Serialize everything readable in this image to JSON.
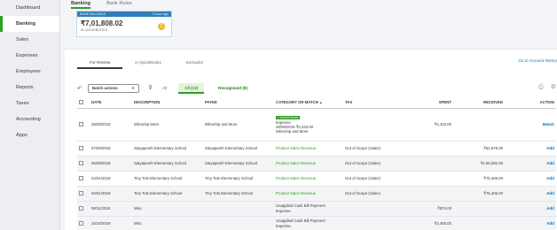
{
  "sidebar": {
    "items": [
      {
        "label": "Dashboard"
      },
      {
        "label": "Banking"
      },
      {
        "label": "Sales"
      },
      {
        "label": "Expenses"
      },
      {
        "label": "Employees"
      },
      {
        "label": "Reports"
      },
      {
        "label": "Taxes"
      },
      {
        "label": "Accounting"
      },
      {
        "label": "Apps"
      }
    ],
    "active_index": 1
  },
  "top_tabs": [
    {
      "label": "Banking"
    },
    {
      "label": "Bank Rules"
    }
  ],
  "bank_card": {
    "header_left": "BANK BALANCE",
    "header_right": "1 hour ago",
    "amount": "₹7,01,808.02",
    "sublabel": "IN QUICKBOOKS",
    "warn_glyph": "!"
  },
  "review_tabs": [
    {
      "label": "For Review"
    },
    {
      "label": "In QuickBooks"
    },
    {
      "label": "Excluded"
    }
  ],
  "go_register": "Go to Account history",
  "toolbar": {
    "batch_actions": "Batch actions",
    "filter_all": "All",
    "pill_all": "All (12)",
    "pill_recognised": "Recognised (8)"
  },
  "table": {
    "headers": [
      "DATE",
      "DESCRIPTION",
      "PAYEE",
      "CATEGORY OR MATCH",
      "TAX",
      "SPENT",
      "RECEIVED",
      "ACTION"
    ],
    "rows": [
      {
        "date": "28/08/2018",
        "description": "Milroship More",
        "payee": "Milroship and More",
        "badge": "1 record found",
        "cat1": "Expense",
        "cat2": "28/08/2018 ₹2,423.00",
        "cat3": "Milroship and More",
        "tax": "",
        "spent": "₹2,423.00",
        "received": "",
        "action": "Match"
      },
      {
        "date": "07/09/2018",
        "description": "Satyapeeth Elementary School",
        "payee": "Satyapeeth Elementary School",
        "category": "Product Sales Revenue",
        "tax": "Out of Scope (Sales)",
        "spent": "",
        "received": "₹52,678.00",
        "action": "Add"
      },
      {
        "date": "05/09/2018",
        "description": "Satyapeeth Elementary School",
        "payee": "Satyapeeth Elementary School",
        "category": "Product Sales Revenue",
        "tax": "Out of Scope (Sales)",
        "spent": "",
        "received": "₹4,05,000.00",
        "action": "Add"
      },
      {
        "date": "04/01/2018",
        "description": "Tiny Tots Elementary School",
        "payee": "Tiny Tots Elementary School",
        "category": "Product Sales Revenue",
        "tax": "Out of Scope (Sales)",
        "spent": "",
        "received": "₹75,406.00",
        "action": "Add"
      },
      {
        "date": "04/01/2018",
        "description": "Tiny Tots Elementary School",
        "payee": "Tiny Tots Elementary School",
        "category": "Product Sales Revenue",
        "tax": "Out of Scope (Sales)",
        "spent": "",
        "received": "₹75,406.00",
        "action": "Add"
      },
      {
        "date": "08/11/2018",
        "description": "Misc",
        "payee": "",
        "cat1": "Unapplied Cash Bill Payment",
        "cat2": "Expense",
        "tax": "",
        "spent": "₹874.00",
        "received": "",
        "action": "Add"
      },
      {
        "date": "10/10/2018",
        "description": "Misc",
        "payee": "",
        "cat1": "Unapplied Cash Bill Payment",
        "cat2": "Expense",
        "tax": "",
        "spent": "₹2,450.00",
        "received": "",
        "action": "Add"
      }
    ]
  },
  "colors": {
    "accent_green": "#2ca01c",
    "link_blue": "#0077c5",
    "card_blue": "#2e7fb8",
    "warn_yellow": "#f0b92a"
  },
  "icons": [
    "undo-icon",
    "filter-icon",
    "print-icon",
    "settings-icon",
    "sort-arrow-icon",
    "cursor-arrow-icon"
  ]
}
